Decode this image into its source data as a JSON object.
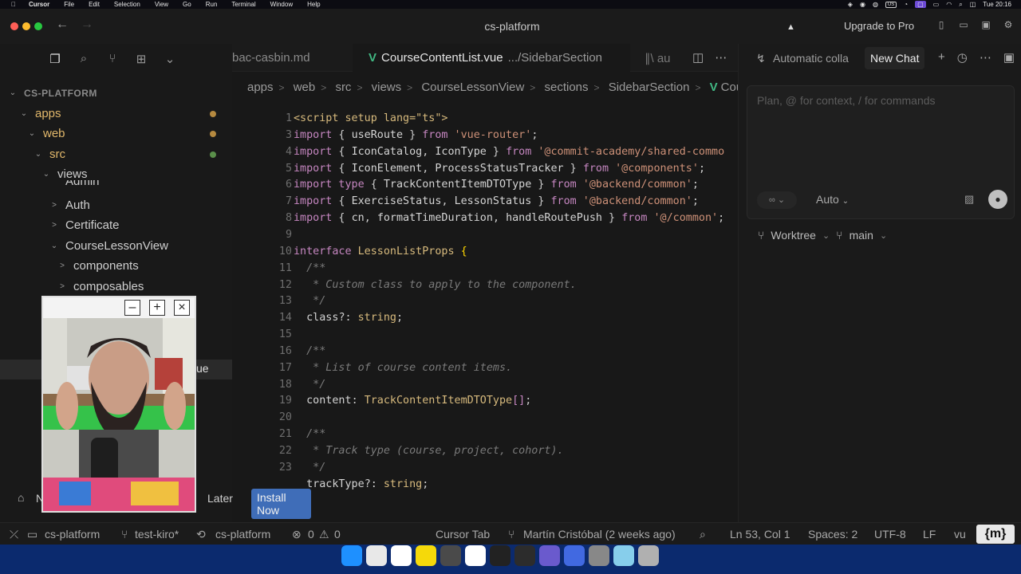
{
  "menubar": {
    "app": "Cursor",
    "items": [
      "File",
      "Edit",
      "Selection",
      "View",
      "Go",
      "Run",
      "Terminal",
      "Window",
      "Help"
    ],
    "keyboard": "US",
    "clock": "Tue 20:16"
  },
  "window": {
    "title": "cs-platform",
    "upgrade": "Upgrade to Pro"
  },
  "sidebar": {
    "root": "CS-PLATFORM",
    "tree": [
      {
        "label": "apps",
        "chev": "⌄",
        "style": "orange",
        "dot": "orange"
      },
      {
        "label": "web",
        "chev": "⌄",
        "style": "orange",
        "dot": "orange"
      },
      {
        "label": "src",
        "chev": "⌄",
        "style": "orange",
        "dot": "green"
      },
      {
        "label": "views",
        "chev": "⌄",
        "style": "normal",
        "dot": ""
      },
      {
        "label": "Admin",
        "chev": "",
        "style": "normal",
        "dot": ""
      },
      {
        "label": "Auth",
        "chev": ">",
        "style": "normal",
        "dot": ""
      },
      {
        "label": "Certificate",
        "chev": ">",
        "style": "normal",
        "dot": ""
      },
      {
        "label": "CourseLessonView",
        "chev": "⌄",
        "style": "normal",
        "dot": ""
      },
      {
        "label": "components",
        "chev": ">",
        "style": "normal",
        "dot": ""
      },
      {
        "label": "composables",
        "chev": ">",
        "style": "normal",
        "dot": ""
      }
    ],
    "selected_tail": "ue"
  },
  "popup": {
    "n_label": "N",
    "later": "Later",
    "install": "Install Now"
  },
  "editor": {
    "prev_tab": "bac-casbin.md",
    "active_tab": "CourseContentList.vue",
    "active_tab_desc": ".../SidebarSection",
    "next_tab": "au",
    "breadcrumbs": [
      "apps",
      "web",
      "src",
      "views",
      "CourseLessonView",
      "sections",
      "SidebarSection"
    ],
    "breadcrumb_tail": "Cou",
    "lines": [
      {
        "n": "1",
        "segs": [
          [
            "<script setup lang=\"ts\">",
            "kw2"
          ]
        ]
      },
      {
        "n": "3",
        "segs": [
          [
            "import",
            "kw"
          ],
          [
            " { ",
            "punc"
          ],
          [
            "useRoute",
            "id"
          ],
          [
            " } ",
            "punc"
          ],
          [
            "from",
            "kw"
          ],
          [
            " 'vue-router'",
            "str"
          ],
          [
            ";",
            "punc"
          ]
        ]
      },
      {
        "n": "4",
        "segs": [
          [
            "import",
            "kw"
          ],
          [
            " { ",
            "punc"
          ],
          [
            "IconCatalog",
            "id"
          ],
          [
            ", ",
            "punc"
          ],
          [
            "IconType",
            "id"
          ],
          [
            " } ",
            "punc"
          ],
          [
            "from",
            "kw"
          ],
          [
            " '@commit-academy/shared-commo",
            "str"
          ]
        ]
      },
      {
        "n": "5",
        "segs": [
          [
            "import",
            "kw"
          ],
          [
            " { ",
            "punc"
          ],
          [
            "IconElement",
            "id"
          ],
          [
            ", ",
            "punc"
          ],
          [
            "ProcessStatusTracker",
            "id"
          ],
          [
            " } ",
            "punc"
          ],
          [
            "from",
            "kw"
          ],
          [
            " '@components'",
            "str"
          ],
          [
            ";",
            "punc"
          ]
        ]
      },
      {
        "n": "6",
        "segs": [
          [
            "import",
            "kw"
          ],
          [
            " type",
            "kw"
          ],
          [
            " { ",
            "punc"
          ],
          [
            "TrackContentItemDTOType",
            "id"
          ],
          [
            " } ",
            "punc"
          ],
          [
            "from",
            "kw"
          ],
          [
            " '@backend/common'",
            "str"
          ],
          [
            ";",
            "punc"
          ]
        ]
      },
      {
        "n": "7",
        "segs": [
          [
            "import",
            "kw"
          ],
          [
            " { ",
            "punc"
          ],
          [
            "ExerciseStatus",
            "id"
          ],
          [
            ", ",
            "punc"
          ],
          [
            "LessonStatus",
            "id"
          ],
          [
            " } ",
            "punc"
          ],
          [
            "from",
            "kw"
          ],
          [
            " '@backend/common'",
            "str"
          ],
          [
            ";",
            "punc"
          ]
        ]
      },
      {
        "n": "8",
        "segs": [
          [
            "import",
            "kw"
          ],
          [
            " { ",
            "punc"
          ],
          [
            "cn",
            "id"
          ],
          [
            ", ",
            "punc"
          ],
          [
            "formatTimeDuration",
            "id"
          ],
          [
            ", ",
            "punc"
          ],
          [
            "handleRoutePush",
            "id"
          ],
          [
            " } ",
            "punc"
          ],
          [
            "from",
            "kw"
          ],
          [
            " '@/common'",
            "str"
          ],
          [
            ";",
            "punc"
          ]
        ]
      },
      {
        "n": "9",
        "segs": []
      },
      {
        "n": "10",
        "segs": [
          [
            "interface",
            "kw"
          ],
          [
            " LessonListProps",
            "ty"
          ],
          [
            " {",
            "br"
          ]
        ]
      },
      {
        "n": "11",
        "segs": [
          [
            "  /**",
            "cm"
          ]
        ]
      },
      {
        "n": "12",
        "segs": [
          [
            "   * Custom class to apply to the component.",
            "cm"
          ]
        ]
      },
      {
        "n": "13",
        "segs": [
          [
            "   */",
            "cm"
          ]
        ]
      },
      {
        "n": "14",
        "segs": [
          [
            "  class",
            "prop"
          ],
          [
            "?: ",
            "punc"
          ],
          [
            "string",
            "ty"
          ],
          [
            ";",
            "punc"
          ]
        ]
      },
      {
        "n": "15",
        "segs": []
      },
      {
        "n": "16",
        "segs": [
          [
            "  /**",
            "cm"
          ]
        ]
      },
      {
        "n": "17",
        "segs": [
          [
            "   * List of course content items.",
            "cm"
          ]
        ]
      },
      {
        "n": "18",
        "segs": [
          [
            "   */",
            "cm"
          ]
        ]
      },
      {
        "n": "19",
        "segs": [
          [
            "  content",
            "prop"
          ],
          [
            ": ",
            "punc"
          ],
          [
            "TrackContentItemDTOType",
            "ty"
          ],
          [
            "[]",
            "kw"
          ],
          [
            ";",
            "punc"
          ]
        ]
      },
      {
        "n": "20",
        "segs": []
      },
      {
        "n": "21",
        "segs": [
          [
            "  /**",
            "cm"
          ]
        ]
      },
      {
        "n": "22",
        "segs": [
          [
            "   * Track type (course, project, cohort).",
            "cm"
          ]
        ]
      },
      {
        "n": "23",
        "segs": [
          [
            "   */",
            "cm"
          ]
        ]
      },
      {
        "n": "",
        "segs": [
          [
            "  trackType",
            "prop"
          ],
          [
            "?: ",
            "punc"
          ],
          [
            "string",
            "ty"
          ],
          [
            ";",
            "punc"
          ]
        ]
      }
    ]
  },
  "chat": {
    "auto_label": "Automatic colla",
    "new_chat": "New Chat",
    "placeholder": "Plan, @ for context, / for commands",
    "mode": "∞",
    "model": "Auto",
    "worktree": "Worktree",
    "branch": "main"
  },
  "statusbar": {
    "workspace": "cs-platform",
    "branch": "test-kiro*",
    "repo": "cs-platform",
    "errors": "0",
    "warnings": "0",
    "cursor_tab": "Cursor Tab",
    "blame": "Martín Cristóbal (2 weeks ago)",
    "position": "Ln 53, Col 1",
    "spaces": "Spaces: 2",
    "encoding": "UTF-8",
    "eol": "LF",
    "lang": "vu",
    "logo": "{m}"
  },
  "dock": {
    "colors": [
      "#1e90ff",
      "#e8e8e8",
      "#ffffff",
      "#f5d90a",
      "#4a4a4a",
      "#ffffff",
      "#222222",
      "#2c2c2c",
      "#6a5acd",
      "#4169e1",
      "#888888",
      "#87ceeb",
      "#b0b0b0"
    ]
  }
}
